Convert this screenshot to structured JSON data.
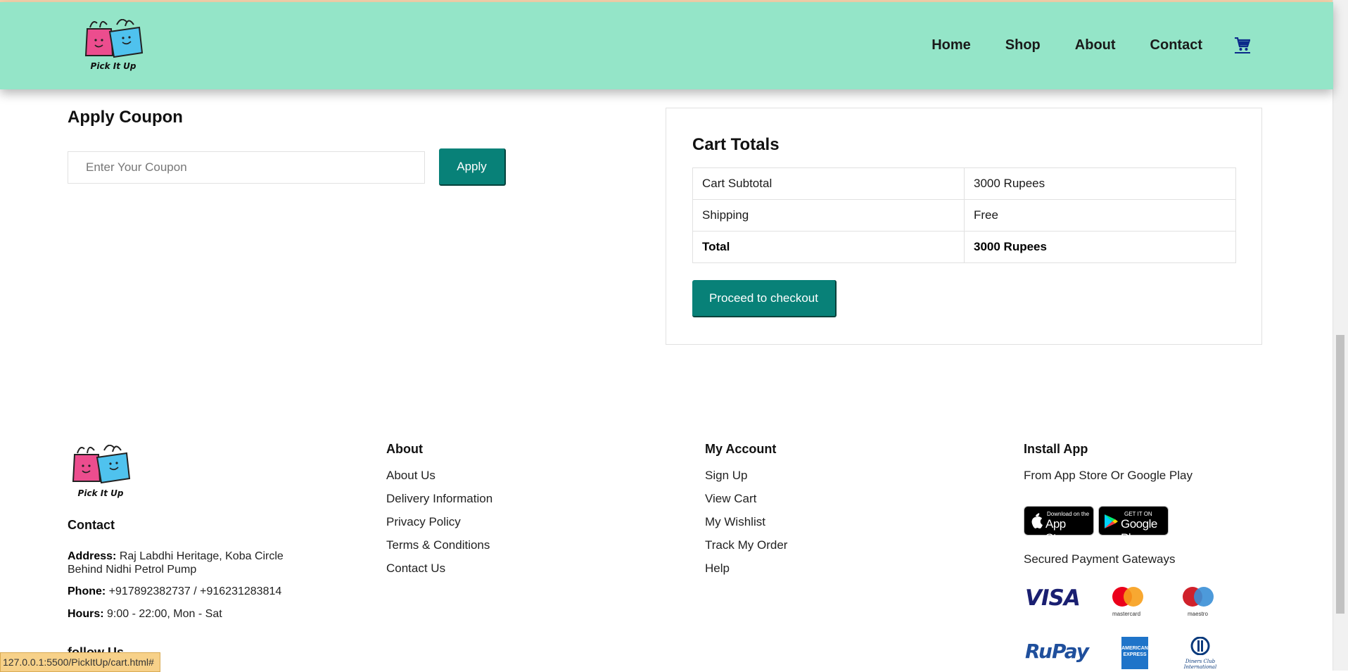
{
  "header": {
    "logo_text": "Pick It Up",
    "nav": [
      {
        "label": "Home"
      },
      {
        "label": "Shop"
      },
      {
        "label": "About"
      },
      {
        "label": "Contact"
      }
    ],
    "cart_icon": "cart-icon"
  },
  "coupon": {
    "title": "Apply Coupon",
    "placeholder": "Enter Your Coupon",
    "value": "",
    "button": "Apply"
  },
  "cart_totals": {
    "title": "Cart Totals",
    "rows": [
      {
        "label": "Cart Subtotal",
        "value": "3000 Rupees"
      },
      {
        "label": "Shipping",
        "value": "Free"
      },
      {
        "label": "Total",
        "value": "3000 Rupees"
      }
    ],
    "checkout_button": "Proceed to checkout"
  },
  "footer": {
    "logo_text": "Pick It Up",
    "contact": {
      "title": "Contact",
      "address_label": "Address:",
      "address_line1": "Raj Labdhi Heritage, Koba Circle",
      "address_line2": "Behind Nidhi Petrol Pump",
      "phone_label": "Phone:",
      "phone": "+917892382737 / +916231283814",
      "hours_label": "Hours:",
      "hours": "9:00 - 22:00, Mon - Sat",
      "follow_title": "follow Us"
    },
    "about": {
      "title": "About",
      "links": [
        "About Us",
        "Delivery Information",
        "Privacy Policy",
        "Terms & Conditions",
        "Contact Us"
      ]
    },
    "account": {
      "title": "My Account",
      "links": [
        "Sign Up",
        "View Cart",
        "My Wishlist",
        "Track My Order",
        "Help"
      ]
    },
    "install": {
      "title": "Install App",
      "subtitle": "From App Store Or Google Play",
      "app_store_small": "Download on the",
      "app_store_big": "App Store",
      "google_play_small": "GET IT ON",
      "google_play_big": "Google Play",
      "payments_title": "Secured Payment Gateways",
      "payment_logos": {
        "visa": "VISA",
        "mastercard": "mastercard",
        "maestro": "maestro",
        "rupay": "RuPay",
        "amex_line1": "AMERICAN",
        "amex_line2": "EXPRESS",
        "diners_line1": "Diners Club",
        "diners_line2": "International"
      }
    }
  },
  "status_bar": {
    "url": "127.0.0.1:5500/PickItUp/cart.html#"
  },
  "colors": {
    "header_bg": "#94e5c8",
    "accent": "#088178",
    "nav_text": "#1a1a1a",
    "cart_icon": "#0b2a8a"
  }
}
